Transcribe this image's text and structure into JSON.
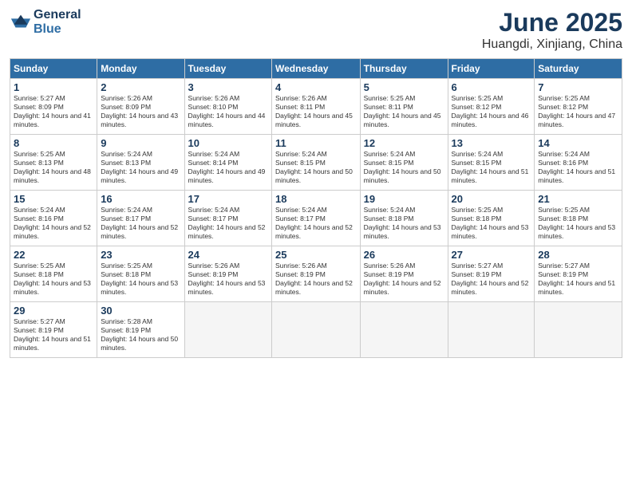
{
  "header": {
    "logo_line1": "General",
    "logo_line2": "Blue",
    "month": "June 2025",
    "location": "Huangdi, Xinjiang, China"
  },
  "weekdays": [
    "Sunday",
    "Monday",
    "Tuesday",
    "Wednesday",
    "Thursday",
    "Friday",
    "Saturday"
  ],
  "weeks": [
    [
      {
        "day": "1",
        "sunrise": "5:27 AM",
        "sunset": "8:09 PM",
        "daylight": "14 hours and 41 minutes."
      },
      {
        "day": "2",
        "sunrise": "5:26 AM",
        "sunset": "8:09 PM",
        "daylight": "14 hours and 43 minutes."
      },
      {
        "day": "3",
        "sunrise": "5:26 AM",
        "sunset": "8:10 PM",
        "daylight": "14 hours and 44 minutes."
      },
      {
        "day": "4",
        "sunrise": "5:26 AM",
        "sunset": "8:11 PM",
        "daylight": "14 hours and 45 minutes."
      },
      {
        "day": "5",
        "sunrise": "5:25 AM",
        "sunset": "8:11 PM",
        "daylight": "14 hours and 45 minutes."
      },
      {
        "day": "6",
        "sunrise": "5:25 AM",
        "sunset": "8:12 PM",
        "daylight": "14 hours and 46 minutes."
      },
      {
        "day": "7",
        "sunrise": "5:25 AM",
        "sunset": "8:12 PM",
        "daylight": "14 hours and 47 minutes."
      }
    ],
    [
      {
        "day": "8",
        "sunrise": "5:25 AM",
        "sunset": "8:13 PM",
        "daylight": "14 hours and 48 minutes."
      },
      {
        "day": "9",
        "sunrise": "5:24 AM",
        "sunset": "8:13 PM",
        "daylight": "14 hours and 49 minutes."
      },
      {
        "day": "10",
        "sunrise": "5:24 AM",
        "sunset": "8:14 PM",
        "daylight": "14 hours and 49 minutes."
      },
      {
        "day": "11",
        "sunrise": "5:24 AM",
        "sunset": "8:15 PM",
        "daylight": "14 hours and 50 minutes."
      },
      {
        "day": "12",
        "sunrise": "5:24 AM",
        "sunset": "8:15 PM",
        "daylight": "14 hours and 50 minutes."
      },
      {
        "day": "13",
        "sunrise": "5:24 AM",
        "sunset": "8:15 PM",
        "daylight": "14 hours and 51 minutes."
      },
      {
        "day": "14",
        "sunrise": "5:24 AM",
        "sunset": "8:16 PM",
        "daylight": "14 hours and 51 minutes."
      }
    ],
    [
      {
        "day": "15",
        "sunrise": "5:24 AM",
        "sunset": "8:16 PM",
        "daylight": "14 hours and 52 minutes."
      },
      {
        "day": "16",
        "sunrise": "5:24 AM",
        "sunset": "8:17 PM",
        "daylight": "14 hours and 52 minutes."
      },
      {
        "day": "17",
        "sunrise": "5:24 AM",
        "sunset": "8:17 PM",
        "daylight": "14 hours and 52 minutes."
      },
      {
        "day": "18",
        "sunrise": "5:24 AM",
        "sunset": "8:17 PM",
        "daylight": "14 hours and 52 minutes."
      },
      {
        "day": "19",
        "sunrise": "5:24 AM",
        "sunset": "8:18 PM",
        "daylight": "14 hours and 53 minutes."
      },
      {
        "day": "20",
        "sunrise": "5:25 AM",
        "sunset": "8:18 PM",
        "daylight": "14 hours and 53 minutes."
      },
      {
        "day": "21",
        "sunrise": "5:25 AM",
        "sunset": "8:18 PM",
        "daylight": "14 hours and 53 minutes."
      }
    ],
    [
      {
        "day": "22",
        "sunrise": "5:25 AM",
        "sunset": "8:18 PM",
        "daylight": "14 hours and 53 minutes."
      },
      {
        "day": "23",
        "sunrise": "5:25 AM",
        "sunset": "8:18 PM",
        "daylight": "14 hours and 53 minutes."
      },
      {
        "day": "24",
        "sunrise": "5:26 AM",
        "sunset": "8:19 PM",
        "daylight": "14 hours and 53 minutes."
      },
      {
        "day": "25",
        "sunrise": "5:26 AM",
        "sunset": "8:19 PM",
        "daylight": "14 hours and 52 minutes."
      },
      {
        "day": "26",
        "sunrise": "5:26 AM",
        "sunset": "8:19 PM",
        "daylight": "14 hours and 52 minutes."
      },
      {
        "day": "27",
        "sunrise": "5:27 AM",
        "sunset": "8:19 PM",
        "daylight": "14 hours and 52 minutes."
      },
      {
        "day": "28",
        "sunrise": "5:27 AM",
        "sunset": "8:19 PM",
        "daylight": "14 hours and 51 minutes."
      }
    ],
    [
      {
        "day": "29",
        "sunrise": "5:27 AM",
        "sunset": "8:19 PM",
        "daylight": "14 hours and 51 minutes."
      },
      {
        "day": "30",
        "sunrise": "5:28 AM",
        "sunset": "8:19 PM",
        "daylight": "14 hours and 50 minutes."
      },
      null,
      null,
      null,
      null,
      null
    ]
  ]
}
